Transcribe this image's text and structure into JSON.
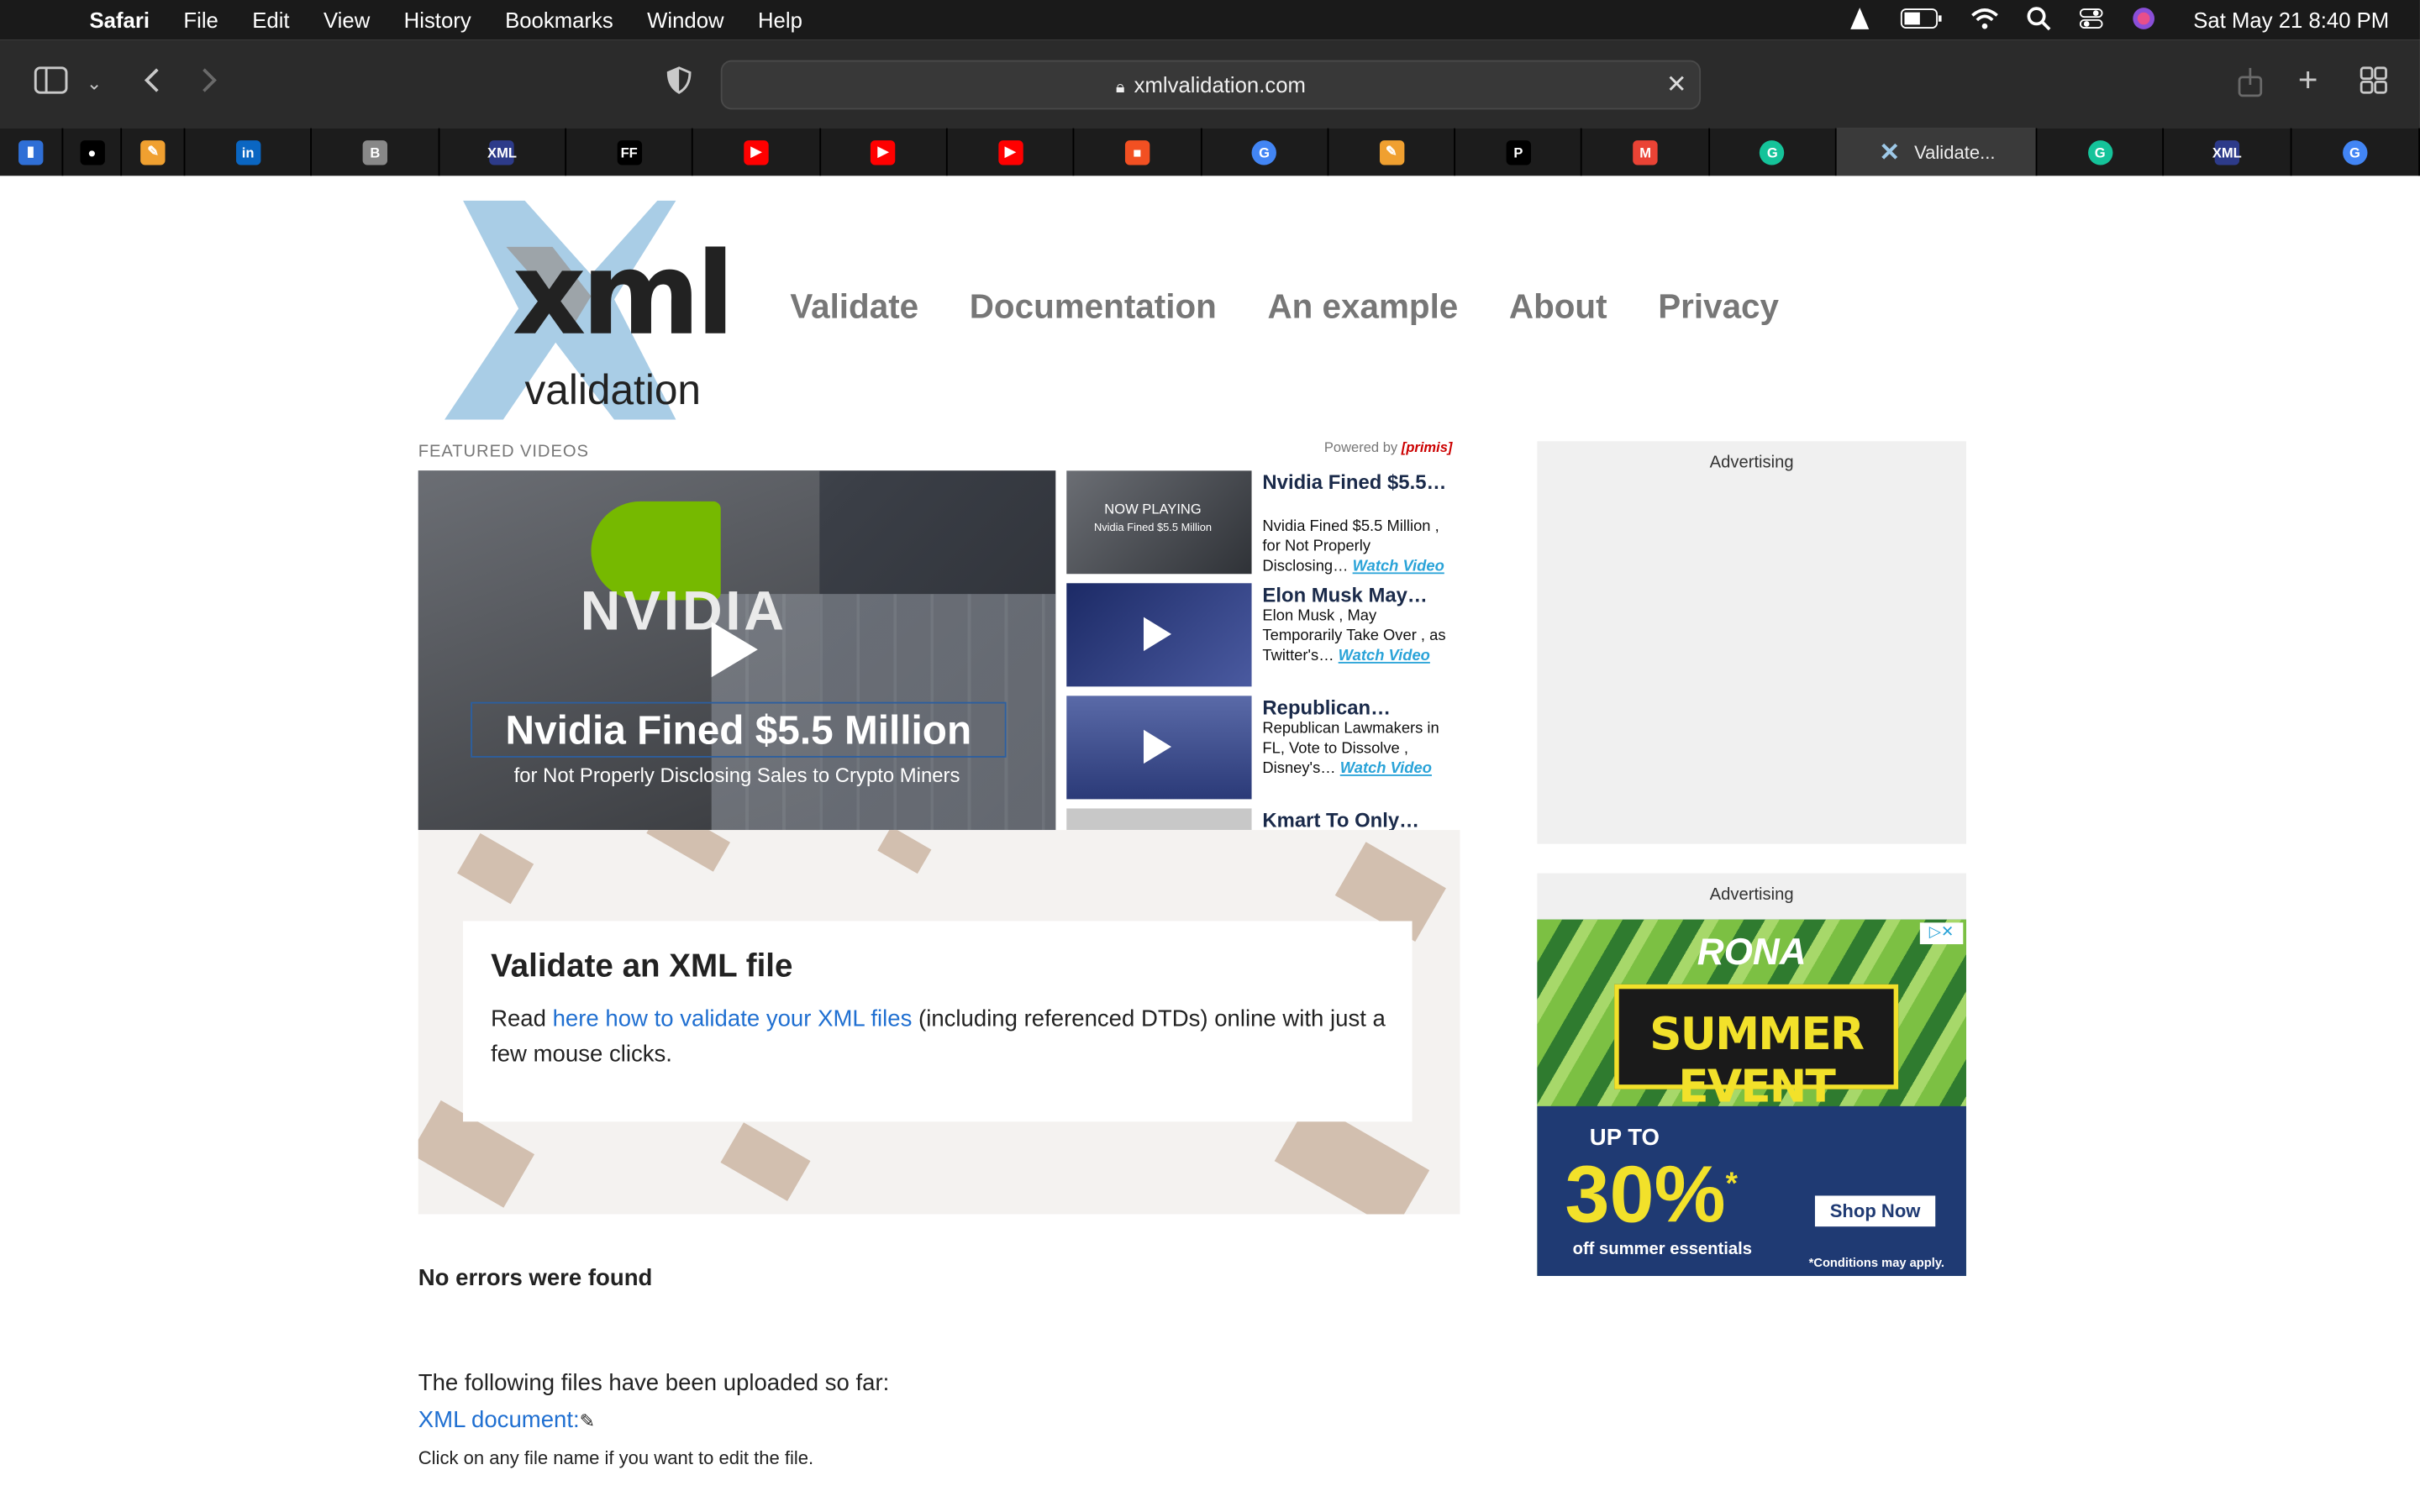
{
  "menubar": {
    "app": "Safari",
    "menus": [
      "File",
      "Edit",
      "View",
      "History",
      "Bookmarks",
      "Window",
      "Help"
    ],
    "clock": "Sat May 21  8:40 PM"
  },
  "toolbar": {
    "url": "xmlvalidation.com"
  },
  "tabs": [
    {
      "icon": "bar-chart-icon",
      "color": "#2f6fd6",
      "label": ""
    },
    {
      "icon": "github-icon",
      "color": "#ffffff",
      "label": ""
    },
    {
      "icon": "notes-icon",
      "color": "#f0a030",
      "label": ""
    },
    {
      "icon": "linkedin-icon",
      "color": "#0a66c2",
      "label": ""
    },
    {
      "icon": "b-icon",
      "color": "#888888",
      "label": ""
    },
    {
      "icon": "xml-icon",
      "color": "#2d3b8a",
      "label": ""
    },
    {
      "icon": "ff-icon",
      "color": "#000000",
      "label": ""
    },
    {
      "icon": "youtube-icon",
      "color": "#ff0000",
      "label": ""
    },
    {
      "icon": "youtube-icon",
      "color": "#ff0000",
      "label": ""
    },
    {
      "icon": "youtube-icon",
      "color": "#ff0000",
      "label": ""
    },
    {
      "icon": "microsoft-icon",
      "color": "#f25022",
      "label": ""
    },
    {
      "icon": "google-icon",
      "color": "#4285f4",
      "label": ""
    },
    {
      "icon": "notes-icon",
      "color": "#f0a030",
      "label": ""
    },
    {
      "icon": "playstation-icon",
      "color": "#ffffff",
      "label": ""
    },
    {
      "icon": "gmail-icon",
      "color": "#ea4335",
      "label": ""
    },
    {
      "icon": "grammarly-icon",
      "color": "#15c39a",
      "label": ""
    },
    {
      "icon": "xmlvalidation-icon",
      "color": "#9ec9e8",
      "label": "Validate..."
    },
    {
      "icon": "grammarly-icon",
      "color": "#15c39a",
      "label": ""
    },
    {
      "icon": "xml-icon",
      "color": "#2d3b8a",
      "label": ""
    },
    {
      "icon": "google-icon",
      "color": "#4285f4",
      "label": ""
    }
  ],
  "site": {
    "logo_main": "xml",
    "logo_sub": "validation",
    "nav": [
      "Validate",
      "Documentation",
      "An example",
      "About",
      "Privacy"
    ]
  },
  "videos": {
    "featured_label": "FEATURED VIDEOS",
    "powered_by": "Powered by",
    "powered_brand": "[primis]",
    "main_caption": "Nvidia Fined $5.5 Million",
    "main_subcaption": "for Not Properly Disclosing Sales to Crypto Miners",
    "main_logo_word": "NVIDIA",
    "now_playing": "NOW PLAYING",
    "now_playing_sub": "Nvidia Fined $5.5 Million",
    "items": [
      {
        "title": "Nvidia Fined $5.5…",
        "desc": "Nvidia Fined $5.5 Million , for Not Properly Disclosing…",
        "watch": "Watch Video"
      },
      {
        "title": "Elon Musk May…",
        "desc": "Elon Musk , May Temporarily Take Over , as Twitter's…",
        "watch": "Watch Video"
      },
      {
        "title": "Republican…",
        "desc": "Republican Lawmakers in FL, Vote to Dissolve , Disney's…",
        "watch": "Watch Video"
      },
      {
        "title": "Kmart To Only…",
        "desc": "",
        "watch": ""
      }
    ]
  },
  "validate_card": {
    "title": "Validate an XML file",
    "text_before": "Read ",
    "link": "here how to validate your XML files",
    "text_after": " (including referenced DTDs) online with just a few mouse clicks."
  },
  "ads": {
    "label1": "Advertising",
    "label2": "Advertising",
    "rona_brand": "RONA",
    "rona_event": "SUMMER EVENT",
    "rona_upto": "UP TO",
    "rona_pct": "30%",
    "rona_star": "*",
    "rona_off": "off summer essentials",
    "rona_shop": "Shop Now",
    "rona_cond": "*Conditions may apply."
  },
  "results": {
    "status": "No errors were found",
    "uploaded": "The following files have been uploaded so far:",
    "xml_doc": "XML document:",
    "hint": "Click on any file name if you want to edit the file."
  }
}
